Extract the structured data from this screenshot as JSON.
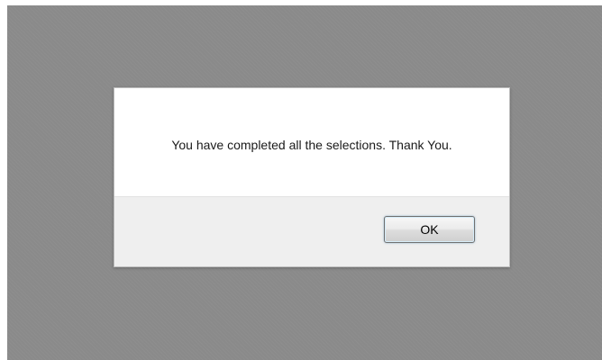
{
  "dialog": {
    "message": "You have completed all the selections. Thank You.",
    "ok_label": "OK"
  },
  "colors": {
    "overlay": "#8a8a8a",
    "dialog_background": "#ffffff",
    "footer_background": "#efefef"
  }
}
